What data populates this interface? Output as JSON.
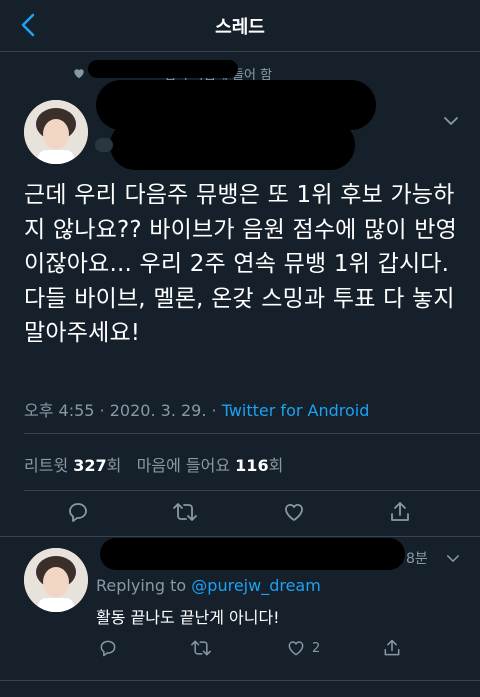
{
  "header": {
    "title": "스레드"
  },
  "social_context": {
    "text": "님이 마음에 들어 함"
  },
  "tweet": {
    "text": "근데 우리 다음주 뮤뱅은 또 1위 후보 가능하지 않나요?? 바이브가 음원 점수에 많이 반영이잖아요... 우리 2주 연속 뮤뱅 1위 갑시다. 다들 바이브, 멜론, 온갖 스밍과 투표 다 놓지 말아주세요!",
    "time": "오후 4:55",
    "date": "2020. 3. 29.",
    "separator": "·",
    "client": "Twitter for Android",
    "retweet_label": "리트윗",
    "retweet_count": "327",
    "retweet_unit": "회",
    "like_label": "마음에 들어요",
    "like_count": "116",
    "like_unit": "회"
  },
  "reply": {
    "time": "8분",
    "replying_to_label": "Replying to",
    "replying_to_handle": "@purejw_dream",
    "text": "활동 끝나도 끝난게 아니다!",
    "like_count": "2"
  },
  "colors": {
    "background": "#15202b",
    "accent": "#1da1f2",
    "secondary_text": "#8899a6",
    "divider": "#38444d"
  }
}
